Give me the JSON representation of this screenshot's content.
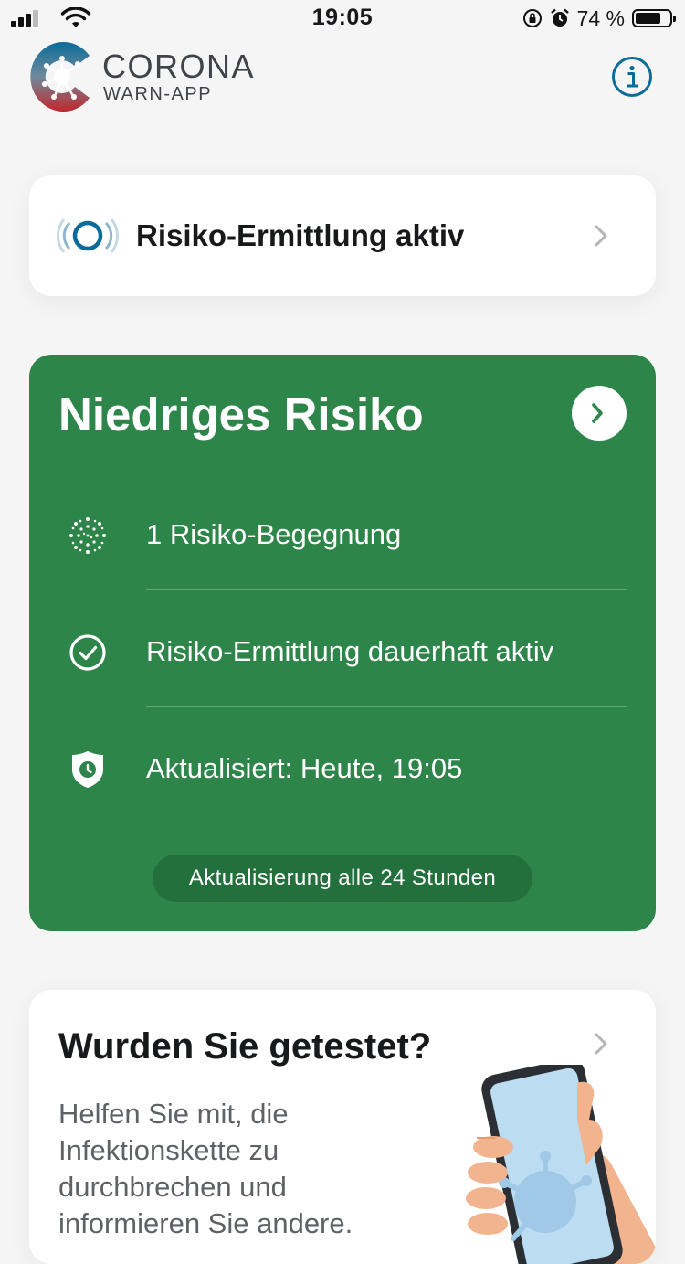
{
  "status_bar": {
    "time": "19:05",
    "battery_percent": "74 %",
    "battery_level": 0.74,
    "icons": [
      "signal-icon",
      "wifi-icon",
      "rotation-lock-icon",
      "alarm-icon",
      "battery-icon"
    ]
  },
  "header": {
    "brand_title": "CORONA",
    "brand_subtitle": "WARN-APP",
    "info_icon": "info-icon"
  },
  "tracing_card": {
    "label": "Risiko-Ermittlung aktiv",
    "icon": "pulse-icon"
  },
  "risk_card": {
    "title": "Niedriges Risiko",
    "color": "#2e854a",
    "items": [
      {
        "icon": "virus-icon",
        "text": "1 Risiko-Begegnung"
      },
      {
        "icon": "checkmark-circle-icon",
        "text": "Risiko-Ermittlung dauerhaft aktiv"
      },
      {
        "icon": "shield-clock-icon",
        "text": "Aktualisiert: Heute, 19:05"
      }
    ],
    "update_pill": "Aktualisierung alle 24 Stunden"
  },
  "test_card": {
    "title": "Wurden Sie getestet?",
    "description": "Helfen Sie mit, die Infektionskette zu durchbrechen und informieren Sie andere."
  },
  "colors": {
    "accent": "#0b6c99",
    "risk_green": "#2e854a",
    "background": "#f5f5f5"
  }
}
